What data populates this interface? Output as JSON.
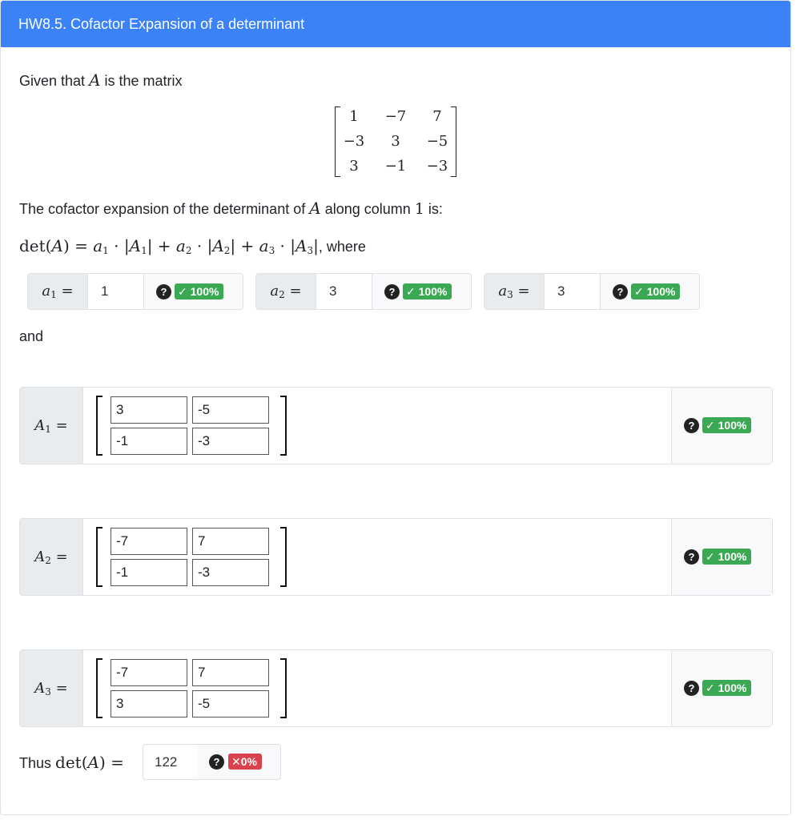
{
  "header": {
    "title": "HW8.5. Cofactor Expansion of a determinant"
  },
  "intro": {
    "given_prefix": "Given that",
    "given_var": "A",
    "given_suffix": "is the matrix"
  },
  "matrix_A": [
    [
      "1",
      "−7",
      "7"
    ],
    [
      "−3",
      "3",
      "−5"
    ],
    [
      "3",
      "−1",
      "−3"
    ]
  ],
  "expansion": {
    "prefix": "The cofactor expansion of the determinant of",
    "var": "A",
    "mid": "along column",
    "col": "1",
    "suffix": "is:",
    "formula_where": ", where"
  },
  "coefficients": [
    {
      "label": "a",
      "sub": "1",
      "value": "1",
      "score": "100%"
    },
    {
      "label": "a",
      "sub": "2",
      "value": "3",
      "score": "100%"
    },
    {
      "label": "a",
      "sub": "3",
      "value": "3",
      "score": "100%"
    }
  ],
  "and_text": "and",
  "submatrices": [
    {
      "label": "A",
      "sub": "1",
      "values": [
        "3",
        "-5",
        "-1",
        "-3"
      ],
      "score": "100%"
    },
    {
      "label": "A",
      "sub": "2",
      "values": [
        "-7",
        "7",
        "-1",
        "-3"
      ],
      "score": "100%"
    },
    {
      "label": "A",
      "sub": "3",
      "values": [
        "-7",
        "7",
        "3",
        "-5"
      ],
      "score": "100%"
    }
  ],
  "final": {
    "prefix": "Thus",
    "det_label": "det(A) =",
    "value": "122",
    "score": "0%"
  },
  "icons": {
    "help": "question-circle-icon",
    "check": "check-icon",
    "cross": "x-icon"
  },
  "colors": {
    "header_bg": "#3b82f6",
    "correct": "#3ba853",
    "incorrect": "#d9434e"
  }
}
